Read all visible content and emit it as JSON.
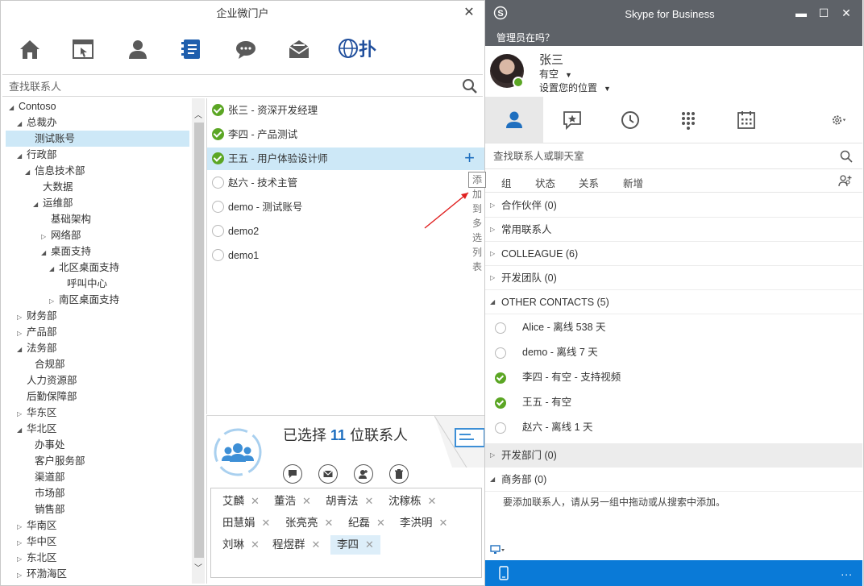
{
  "portal": {
    "title": "企业微门户",
    "close": "✕",
    "brand": "扑",
    "search_placeholder": "查找联系人",
    "tree": [
      {
        "label": "Contoso",
        "arrow": "◢",
        "depth": 0
      },
      {
        "label": "总裁办",
        "arrow": "◢",
        "depth": 1
      },
      {
        "label": "测试账号",
        "arrow": "",
        "depth": 2,
        "selected": true
      },
      {
        "label": "行政部",
        "arrow": "◢",
        "depth": 1
      },
      {
        "label": "信息技术部",
        "arrow": "◢",
        "depth": 2
      },
      {
        "label": "大数据",
        "arrow": "",
        "depth": 3
      },
      {
        "label": "运维部",
        "arrow": "◢",
        "depth": 3
      },
      {
        "label": "基础架构",
        "arrow": "",
        "depth": 4
      },
      {
        "label": "网络部",
        "arrow": "▷",
        "depth": 4
      },
      {
        "label": "桌面支持",
        "arrow": "◢",
        "depth": 4
      },
      {
        "label": "北区桌面支持",
        "arrow": "◢",
        "depth": 5
      },
      {
        "label": "呼叫中心",
        "arrow": "",
        "depth": 6
      },
      {
        "label": "南区桌面支持",
        "arrow": "▷",
        "depth": 5
      },
      {
        "label": "财务部",
        "arrow": "▷",
        "depth": 1
      },
      {
        "label": "产品部",
        "arrow": "▷",
        "depth": 1
      },
      {
        "label": "法务部",
        "arrow": "◢",
        "depth": 1
      },
      {
        "label": "合规部",
        "arrow": "",
        "depth": 2
      },
      {
        "label": "人力资源部",
        "arrow": "",
        "depth": 1
      },
      {
        "label": "后勤保障部",
        "arrow": "",
        "depth": 1
      },
      {
        "label": "华东区",
        "arrow": "▷",
        "depth": 1
      },
      {
        "label": "华北区",
        "arrow": "◢",
        "depth": 1
      },
      {
        "label": "办事处",
        "arrow": "",
        "depth": 2
      },
      {
        "label": "客户服务部",
        "arrow": "",
        "depth": 2
      },
      {
        "label": "渠道部",
        "arrow": "",
        "depth": 2
      },
      {
        "label": "市场部",
        "arrow": "",
        "depth": 2
      },
      {
        "label": "销售部",
        "arrow": "",
        "depth": 2
      },
      {
        "label": "华南区",
        "arrow": "▷",
        "depth": 1
      },
      {
        "label": "华中区",
        "arrow": "▷",
        "depth": 1
      },
      {
        "label": "东北区",
        "arrow": "▷",
        "depth": 1
      },
      {
        "label": "环渤海区",
        "arrow": "▷",
        "depth": 1
      }
    ],
    "members": [
      {
        "label": "张三 - 资深开发经理",
        "status": "on"
      },
      {
        "label": "李四 - 产品测试",
        "status": "on"
      },
      {
        "label": "王五 - 用户体验设计师",
        "status": "on",
        "selected": true
      },
      {
        "label": "赵六 - 技术主管",
        "status": "off"
      },
      {
        "label": "demo - 测试账号",
        "status": "off"
      },
      {
        "label": "demo2",
        "status": "off"
      },
      {
        "label": "demo1",
        "status": "off"
      }
    ],
    "add_plus": "+",
    "add_tooltip": "添加到多选列表",
    "selection": {
      "prefix": "已选择",
      "count": "11",
      "suffix": "位联系人"
    },
    "chips": [
      {
        "label": "艾麟"
      },
      {
        "label": "董浩"
      },
      {
        "label": "胡青法"
      },
      {
        "label": "沈稼栋"
      },
      {
        "label": "田慧娟"
      },
      {
        "label": "张亮亮"
      },
      {
        "label": "纪磊"
      },
      {
        "label": "李洪明"
      },
      {
        "label": "刘琳"
      },
      {
        "label": "程煜群"
      },
      {
        "label": "李四",
        "highlight": true
      }
    ],
    "chip_remove": "✕"
  },
  "skype": {
    "title": "Skype for Business",
    "admin_prompt": "管理员在吗？",
    "me": {
      "name": "张三",
      "status": "有空",
      "location": "设置您的位置"
    },
    "search_placeholder": "查找联系人或聊天室",
    "filters": [
      "组",
      "状态",
      "关系",
      "新增"
    ],
    "groups": [
      {
        "label": "合作伙伴 (0)",
        "expanded": false
      },
      {
        "label": "常用联系人",
        "expanded": false
      },
      {
        "label": "COLLEAGUE (6)",
        "expanded": false
      },
      {
        "label": "开发团队 (0)",
        "expanded": false
      },
      {
        "label": "OTHER CONTACTS (5)",
        "expanded": true
      }
    ],
    "contacts": [
      {
        "label": "Alice  - 离线 538 天",
        "status": "off"
      },
      {
        "label": "demo  - 离线 7 天",
        "status": "off"
      },
      {
        "label": "李四  - 有空 - 支持视频",
        "status": "on"
      },
      {
        "label": "王五  - 有空",
        "status": "on"
      },
      {
        "label": "赵六  - 离线 1 天",
        "status": "off"
      }
    ],
    "groups_after": [
      {
        "label": "开发部门 (0)",
        "expanded": false
      },
      {
        "label": "商务部 (0)",
        "expanded": true
      }
    ],
    "empty_hint": "要添加联系人，请从另一组中拖动或从搜索中添加。",
    "footer_more": "...",
    "colors": {
      "header": "#5e6268",
      "footer": "#0a7ad7",
      "available": "#5ba624",
      "accent": "#1f6fbf"
    }
  }
}
